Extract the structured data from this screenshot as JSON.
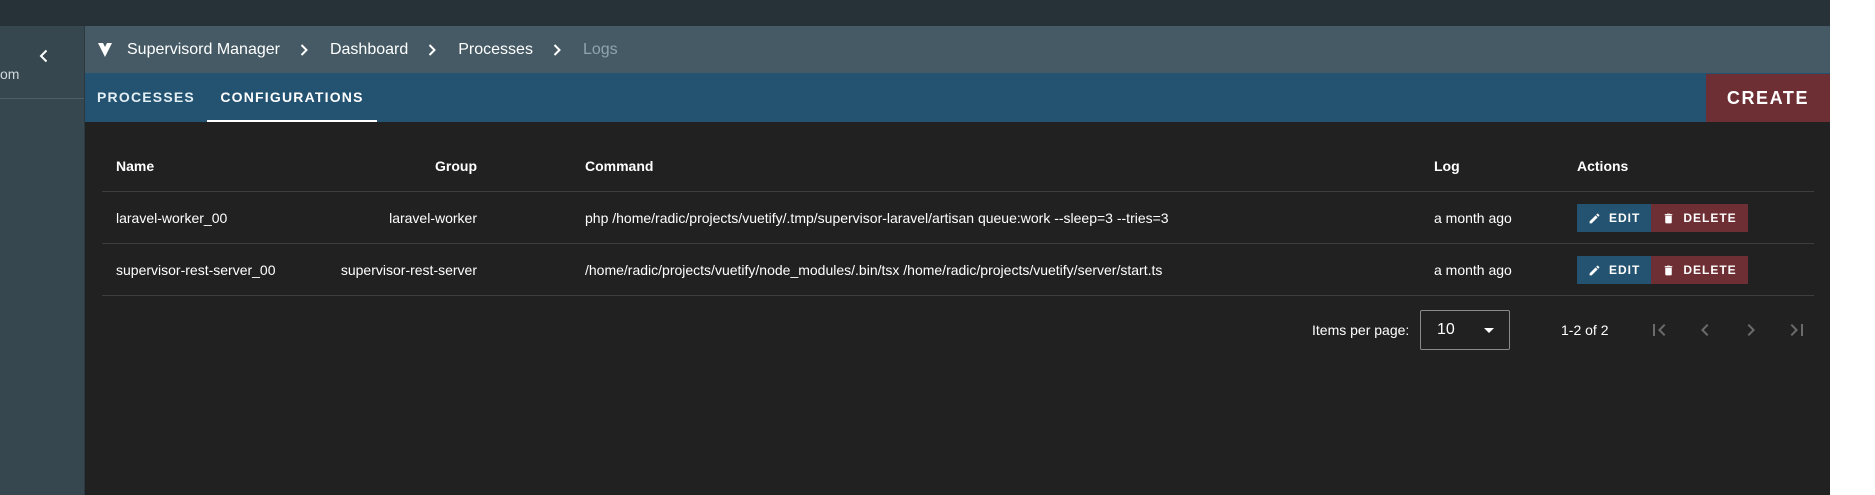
{
  "sidebar": {
    "partial_text": "om"
  },
  "breadcrumbs": [
    {
      "label": "Supervisord Manager"
    },
    {
      "label": "Dashboard"
    },
    {
      "label": "Processes"
    },
    {
      "label": "Logs"
    }
  ],
  "tabs": [
    {
      "label": "PROCESSES",
      "active": false
    },
    {
      "label": "CONFIGURATIONS",
      "active": true
    }
  ],
  "create_label": "CREATE",
  "table": {
    "headers": {
      "name": "Name",
      "group": "Group",
      "command": "Command",
      "log": "Log",
      "actions": "Actions"
    },
    "rows": [
      {
        "name": "laravel-worker_00",
        "group": "laravel-worker",
        "command": "php /home/radic/projects/vuetify/.tmp/supervisor-laravel/artisan queue:work --sleep=3 --tries=3",
        "log": "a month ago",
        "edit_label": "EDIT",
        "delete_label": "DELETE"
      },
      {
        "name": "supervisor-rest-server_00",
        "group": "supervisor-rest-server",
        "command": "/home/radic/projects/vuetify/node_modules/.bin/tsx /home/radic/projects/vuetify/server/start.ts",
        "log": "a month ago",
        "edit_label": "EDIT",
        "delete_label": "DELETE"
      }
    ]
  },
  "pagination": {
    "items_per_page_label": "Items per page:",
    "items_per_page_value": "10",
    "range_text": "1-2 of 2"
  },
  "colors": {
    "primary": "#245371",
    "danger": "#6d2f33",
    "breadcrumb_bar": "#455a64",
    "background": "#212121"
  },
  "icons": [
    "vuetify-logo-icon",
    "chevron-left-icon",
    "chevron-right-icon",
    "pencil-icon",
    "trash-icon",
    "page-first-icon",
    "page-previous-icon",
    "page-next-icon",
    "page-last-icon",
    "menu-down-icon"
  ]
}
